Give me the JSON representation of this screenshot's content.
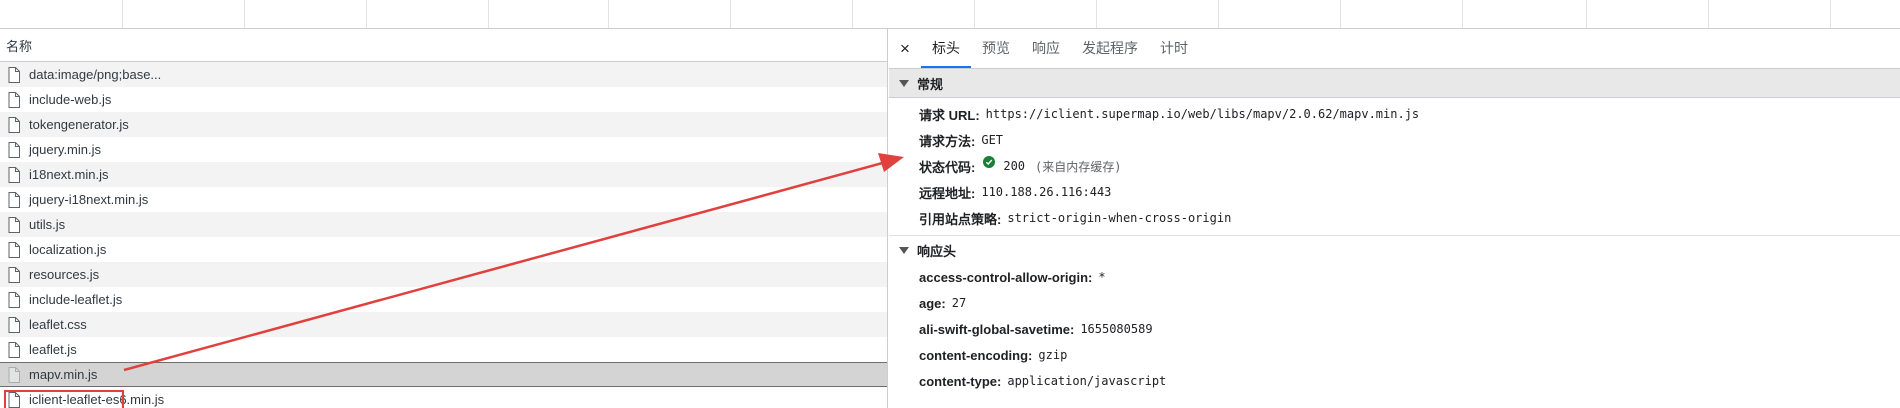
{
  "request_list": {
    "column_header": "名称",
    "rows": [
      {
        "name": "data:image/png;base..."
      },
      {
        "name": "include-web.js"
      },
      {
        "name": "tokengenerator.js"
      },
      {
        "name": "jquery.min.js"
      },
      {
        "name": "i18next.min.js"
      },
      {
        "name": "jquery-i18next.min.js"
      },
      {
        "name": "utils.js"
      },
      {
        "name": "localization.js"
      },
      {
        "name": "resources.js"
      },
      {
        "name": "include-leaflet.js"
      },
      {
        "name": "leaflet.css"
      },
      {
        "name": "leaflet.js"
      },
      {
        "name": "mapv.min.js"
      },
      {
        "name": "iclient-leaflet-es6.min.js"
      }
    ],
    "selected_index": 12
  },
  "detail": {
    "close_glyph": "×",
    "tabs": [
      "标头",
      "预览",
      "响应",
      "发起程序",
      "计时"
    ],
    "active_tab": 0,
    "general": {
      "title": "常规",
      "request_url_label": "请求 URL:",
      "request_url": "https://iclient.supermap.io/web/libs/mapv/2.0.62/mapv.min.js",
      "method_label": "请求方法:",
      "method": "GET",
      "status_label": "状态代码:",
      "status_code": "200",
      "status_note": "(来自内存缓存)",
      "remote_label": "远程地址:",
      "remote_address": "110.188.26.116:443",
      "referrer_label": "引用站点策略:",
      "referrer_policy": "strict-origin-when-cross-origin"
    },
    "response_headers": {
      "title": "响应头",
      "items": [
        {
          "key": "access-control-allow-origin:",
          "value": "*"
        },
        {
          "key": "age:",
          "value": "27"
        },
        {
          "key": "ali-swift-global-savetime:",
          "value": "1655080589"
        },
        {
          "key": "content-encoding:",
          "value": "gzip"
        },
        {
          "key": "content-type:",
          "value": "application/javascript"
        }
      ]
    }
  },
  "colors": {
    "annotation_red": "#e0413e",
    "status_green": "#188038",
    "tab_accent": "#1a73e8"
  }
}
